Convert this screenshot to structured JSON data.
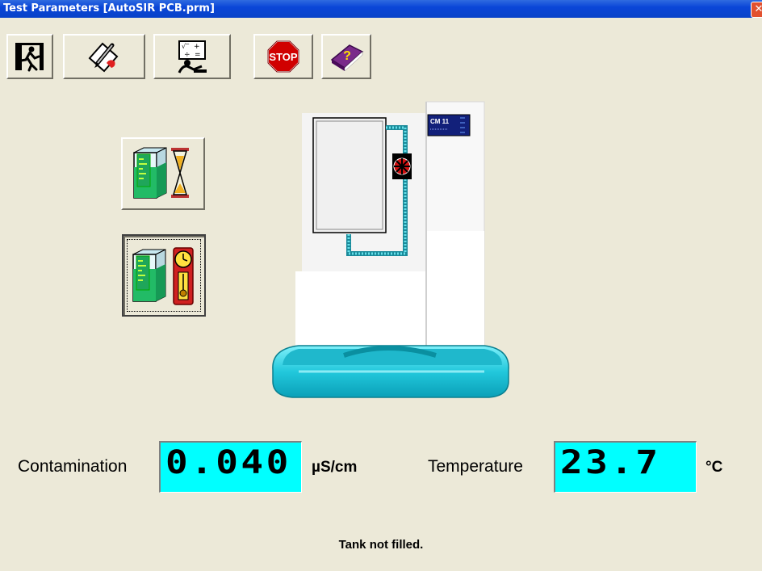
{
  "window": {
    "title": "Test Parameters [AutoSIR PCB.prm]",
    "close_glyph": "✕"
  },
  "toolbar": {
    "items": [
      {
        "name": "exit",
        "icon": "exit-running-man-icon"
      },
      {
        "name": "edit",
        "icon": "pencil-edit-icon"
      },
      {
        "name": "calculate",
        "icon": "operator-calculator-icon"
      },
      {
        "name": "stop",
        "icon": "stop-sign-icon",
        "label": "STOP"
      },
      {
        "name": "help",
        "icon": "help-book-icon",
        "label": "?"
      }
    ]
  },
  "side_buttons": [
    {
      "name": "timed-test",
      "icon": "tank-hourglass-icon",
      "pressed": false
    },
    {
      "name": "clock-test",
      "icon": "tank-clock-icon",
      "pressed": true
    }
  ],
  "instrument": {
    "model_label": "CM 11"
  },
  "readings": {
    "contamination": {
      "label": "Contamination",
      "value": "0.040",
      "unit": "µS/cm"
    },
    "temperature": {
      "label": "Temperature",
      "value": "23.7",
      "unit": "°C"
    }
  },
  "status": {
    "text": "Tank not filled."
  },
  "colors": {
    "readout_bg": "#00FFFF",
    "tank_cyan": "#33CCDD",
    "titlebar": "#0A46D8",
    "stop_red": "#D00000"
  }
}
